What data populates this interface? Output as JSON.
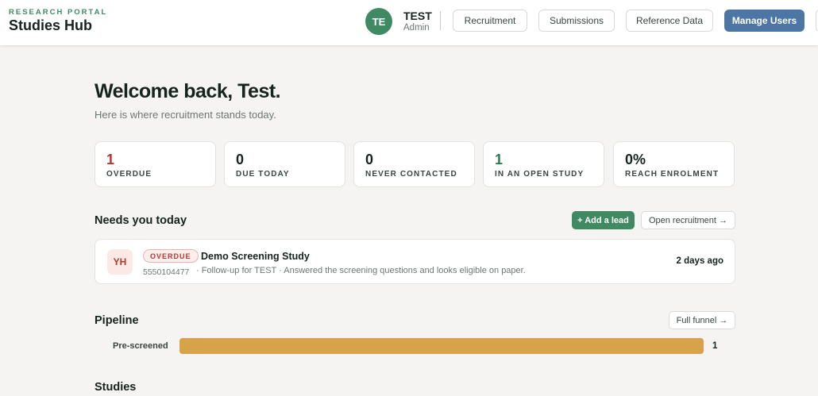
{
  "header": {
    "kicker": "RESEARCH PORTAL",
    "title": "Studies Hub",
    "user": {
      "initials": "TE",
      "name": "TEST",
      "role": "Admin"
    },
    "nav": [
      "Recruitment",
      "Submissions",
      "Reference Data"
    ],
    "primary_action": "Manage Users"
  },
  "welcome": {
    "title": "Welcome back, Test.",
    "subtitle": "Here is where recruitment stands today."
  },
  "stats": [
    {
      "value": "1",
      "label": "OVERDUE"
    },
    {
      "value": "0",
      "label": "DUE TODAY"
    },
    {
      "value": "0",
      "label": "NEVER CONTACTED"
    },
    {
      "value": "1",
      "label": "IN AN OPEN STUDY"
    },
    {
      "value": "0%",
      "label": "REACH ENROLMENT"
    }
  ],
  "needs": {
    "title": "Needs you today",
    "add_lead": "+ Add a lead",
    "open_recruitment": "Open recruitment →",
    "lead": {
      "initials": "YH",
      "badge": "OVERDUE",
      "study": "Demo Screening Study",
      "phone": "5550104477",
      "note": "· Follow-up for TEST · Answered the screening questions and looks eligible on paper.",
      "time": "2 days ago"
    }
  },
  "pipeline": {
    "title": "Pipeline",
    "full_funnel": "Full funnel →",
    "stages": [
      {
        "label": "Pre-screened",
        "count": "1",
        "fraction": 1.0
      }
    ]
  },
  "studies": {
    "title": "Studies"
  },
  "colors": {
    "brand_green": "#3f8a63",
    "primary_blue": "#4e76a4",
    "overdue_red": "#b5372f",
    "pipeline_bar": "#d6a24a"
  }
}
